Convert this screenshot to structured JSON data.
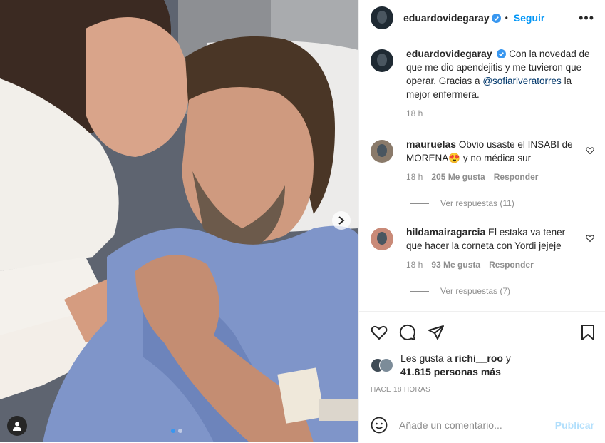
{
  "post": {
    "username": "eduardovidegaray",
    "follow_label": "Seguir",
    "more_label": "•••",
    "separator": "•",
    "caption_parts": {
      "text1": "Con la novedad de que me dio apendejitis y me tuvieron que operar. Gracias a ",
      "mention": "@sofiariveratorres",
      "text2": " la mejor enfermera."
    },
    "caption_time": "18 h"
  },
  "comments": [
    {
      "username": "mauruelas",
      "text": "Obvio usaste el INSABI de MORENA😍 y no médica sur",
      "time": "18 h",
      "likes": "205 Me gusta",
      "reply_label": "Responder",
      "view_replies": "Ver respuestas (11)"
    },
    {
      "username": "hildamairagarcia",
      "text": "El estaka va tener que hacer la corneta con Yordi jejeje",
      "time": "18 h",
      "likes": "93 Me gusta",
      "reply_label": "Responder",
      "view_replies": "Ver respuestas (7)"
    }
  ],
  "likes_summary": {
    "prefix": "Les gusta a ",
    "user": "richi__roo",
    "mid": " y",
    "count_text": "41.815 personas más"
  },
  "post_time": "HACE 18 HORAS",
  "comment_input": {
    "placeholder": "Añade un comentario...",
    "publish_label": "Publicar"
  },
  "colors": {
    "accent": "#0095f6",
    "verified": "#3897f0",
    "publish_disabled": "#b2dffc"
  },
  "icons": [
    "heart-icon",
    "comment-icon",
    "share-icon",
    "bookmark-icon",
    "emoji-icon",
    "more-icon",
    "verified-icon",
    "chevron-right-icon",
    "user-tag-icon"
  ]
}
